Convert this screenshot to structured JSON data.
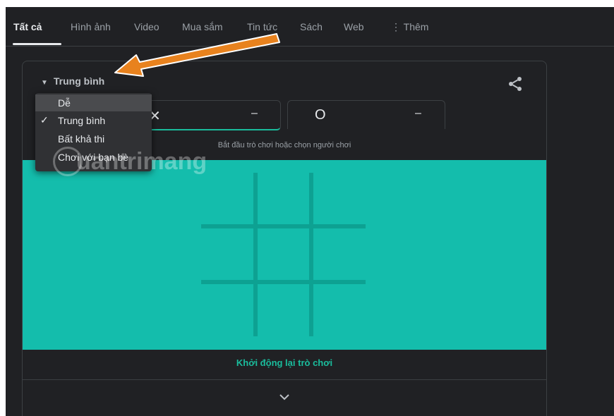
{
  "tabs": [
    {
      "label": "Tất cả",
      "active": true
    },
    {
      "label": "Hình ảnh"
    },
    {
      "label": "Video"
    },
    {
      "label": "Mua sắm"
    },
    {
      "label": "Tin tức"
    },
    {
      "label": "Sách"
    },
    {
      "label": "Web"
    },
    {
      "label": "⋮ Thêm"
    }
  ],
  "game": {
    "difficulty": "Trung bình",
    "player_x": {
      "token": "✕",
      "score": "–"
    },
    "player_o": {
      "token": "O",
      "score": "–"
    },
    "status": "Bắt đầu trò chơi hoặc chọn người chơi",
    "restart": "Khởi động lại trò chơi"
  },
  "menu": {
    "items": [
      {
        "label": "Dễ",
        "highlighted": true
      },
      {
        "label": "Trung bình",
        "checked": true
      },
      {
        "label": "Bất khả thi"
      },
      {
        "label": "Chơi với bạn bè"
      }
    ]
  },
  "watermark": "uantrimang",
  "colors": {
    "background": "#202124",
    "board": "#14bdac",
    "grid": "#0da192",
    "accent": "#1abc9c",
    "arrow": "#e8821e"
  },
  "icons": {
    "share": "share-icon",
    "expand": "chevron-down-icon",
    "caret": "caret-down-icon",
    "check": "check-icon"
  }
}
